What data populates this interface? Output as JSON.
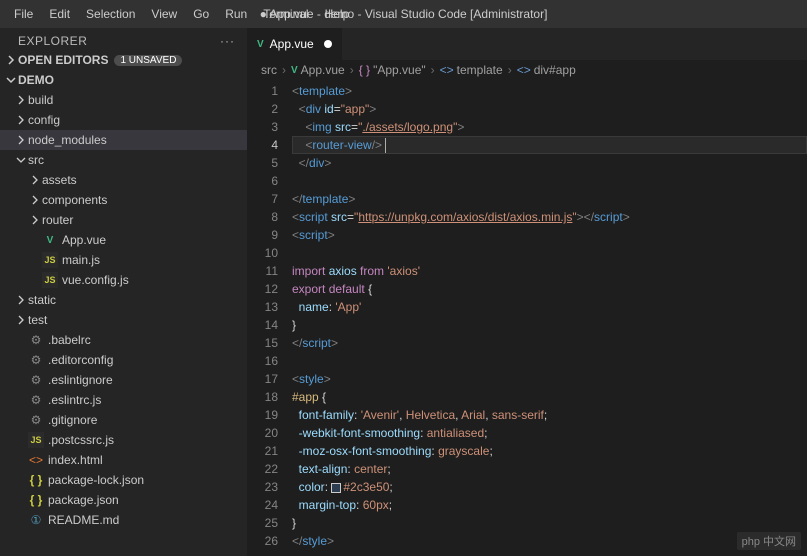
{
  "menu": [
    "File",
    "Edit",
    "Selection",
    "View",
    "Go",
    "Run",
    "Terminal",
    "Help"
  ],
  "title": {
    "modified": "●",
    "file": "App.vue - demo - Visual Studio Code [Administrator]"
  },
  "explorer": {
    "title": "EXPLORER",
    "openEditors": {
      "label": "OPEN EDITORS",
      "badge": "1 UNSAVED"
    },
    "projectName": "DEMO",
    "tree": [
      {
        "type": "folder",
        "expanded": false,
        "indent": 0,
        "label": "build"
      },
      {
        "type": "folder",
        "expanded": false,
        "indent": 0,
        "label": "config"
      },
      {
        "type": "folder",
        "expanded": false,
        "indent": 0,
        "label": "node_modules",
        "selected": true
      },
      {
        "type": "folder",
        "expanded": true,
        "indent": 0,
        "label": "src"
      },
      {
        "type": "folder",
        "expanded": false,
        "indent": 1,
        "label": "assets"
      },
      {
        "type": "folder",
        "expanded": false,
        "indent": 1,
        "label": "components"
      },
      {
        "type": "folder",
        "expanded": false,
        "indent": 1,
        "label": "router"
      },
      {
        "type": "vue",
        "indent": 1,
        "label": "App.vue"
      },
      {
        "type": "js",
        "indent": 1,
        "label": "main.js"
      },
      {
        "type": "js",
        "indent": 1,
        "label": "vue.config.js"
      },
      {
        "type": "folder",
        "expanded": false,
        "indent": 0,
        "label": "static"
      },
      {
        "type": "folder",
        "expanded": false,
        "indent": 0,
        "label": "test"
      },
      {
        "type": "gear",
        "indent": 0,
        "label": ".babelrc"
      },
      {
        "type": "gear",
        "indent": 0,
        "label": ".editorconfig"
      },
      {
        "type": "gear",
        "indent": 0,
        "label": ".eslintignore"
      },
      {
        "type": "gear",
        "indent": 0,
        "label": ".eslintrc.js"
      },
      {
        "type": "gear",
        "indent": 0,
        "label": ".gitignore"
      },
      {
        "type": "js",
        "indent": 0,
        "label": ".postcssrc.js"
      },
      {
        "type": "html",
        "indent": 0,
        "label": "index.html"
      },
      {
        "type": "json",
        "indent": 0,
        "label": "package-lock.json"
      },
      {
        "type": "json",
        "indent": 0,
        "label": "package.json"
      },
      {
        "type": "md",
        "indent": 0,
        "label": "README.md"
      }
    ]
  },
  "tab": {
    "label": "App.vue"
  },
  "breadcrumbs": [
    {
      "icon": "",
      "label": "src"
    },
    {
      "icon": "vue",
      "label": "App.vue"
    },
    {
      "icon": "brace",
      "label": "\"App.vue\""
    },
    {
      "icon": "tag",
      "label": "template"
    },
    {
      "icon": "tag",
      "label": "div#app"
    }
  ],
  "code": {
    "currentLine": 4,
    "lines": [
      {
        "n": 1,
        "html": "<span class='tk-tag'>&lt;</span><span class='tk-el'>template</span><span class='tk-tag'>&gt;</span>"
      },
      {
        "n": 2,
        "html": "  <span class='tk-tag'>&lt;</span><span class='tk-el'>div</span> <span class='tk-attr'>id</span><span class='tk-punc'>=</span><span class='tk-str'>\"app\"</span><span class='tk-tag'>&gt;</span>"
      },
      {
        "n": 3,
        "html": "    <span class='tk-tag'>&lt;</span><span class='tk-el'>img</span> <span class='tk-attr'>src</span><span class='tk-punc'>=</span><span class='tk-str'>\"</span><span class='tk-str-u'>./assets/logo.png</span><span class='tk-str'>\"</span><span class='tk-tag'>&gt;</span>"
      },
      {
        "n": 4,
        "html": "    <span class='tk-tag'>&lt;</span><span class='tk-el'>router-view</span><span class='tk-tag'>/&gt;</span> <span class='caret'></span>",
        "current": true
      },
      {
        "n": 5,
        "html": "  <span class='tk-tag'>&lt;/</span><span class='tk-el'>div</span><span class='tk-tag'>&gt;</span>"
      },
      {
        "n": 6,
        "html": ""
      },
      {
        "n": 7,
        "html": "<span class='tk-tag'>&lt;/</span><span class='tk-el'>template</span><span class='tk-tag'>&gt;</span>"
      },
      {
        "n": 8,
        "html": "<span class='tk-tag'>&lt;</span><span class='tk-el'>script</span> <span class='tk-attr'>src</span><span class='tk-punc'>=</span><span class='tk-str'>\"</span><span class='tk-str-u'>https://unpkg.com/axios/dist/axios.min.js</span><span class='tk-str'>\"</span><span class='tk-tag'>&gt;&lt;/</span><span class='tk-el'>script</span><span class='tk-tag'>&gt;</span>"
      },
      {
        "n": 9,
        "html": "<span class='tk-tag'>&lt;</span><span class='tk-el'>script</span><span class='tk-tag'>&gt;</span>"
      },
      {
        "n": 10,
        "html": ""
      },
      {
        "n": 11,
        "html": "<span class='tk-kw'>import</span> <span class='tk-ident'>axios</span> <span class='tk-kw'>from</span> <span class='tk-str'>'axios'</span>"
      },
      {
        "n": 12,
        "html": "<span class='tk-kw'>export</span> <span class='tk-kw'>default</span> <span class='tk-punc'>{</span>"
      },
      {
        "n": 13,
        "html": "  <span class='tk-ident'>name</span><span class='tk-punc'>:</span> <span class='tk-str'>'App'</span>"
      },
      {
        "n": 14,
        "html": "<span class='tk-punc'>}</span>"
      },
      {
        "n": 15,
        "html": "<span class='tk-tag'>&lt;/</span><span class='tk-el'>script</span><span class='tk-tag'>&gt;</span>"
      },
      {
        "n": 16,
        "html": ""
      },
      {
        "n": 17,
        "html": "<span class='tk-tag'>&lt;</span><span class='tk-el'>style</span><span class='tk-tag'>&gt;</span>"
      },
      {
        "n": 18,
        "html": "<span class='tk-css-sel'>#app</span> <span class='tk-punc'>{</span>"
      },
      {
        "n": 19,
        "html": "  <span class='tk-prop'>font-family</span><span class='tk-punc'>:</span> <span class='tk-css-val'>'Avenir'</span><span class='tk-punc'>,</span> <span class='tk-css-val'>Helvetica</span><span class='tk-punc'>,</span> <span class='tk-css-val'>Arial</span><span class='tk-punc'>,</span> <span class='tk-css-val'>sans-serif</span><span class='tk-punc'>;</span>"
      },
      {
        "n": 20,
        "html": "  <span class='tk-prop'>-webkit-font-smoothing</span><span class='tk-punc'>:</span> <span class='tk-css-val'>antialiased</span><span class='tk-punc'>;</span>"
      },
      {
        "n": 21,
        "html": "  <span class='tk-prop'>-moz-osx-font-smoothing</span><span class='tk-punc'>:</span> <span class='tk-css-val'>grayscale</span><span class='tk-punc'>;</span>"
      },
      {
        "n": 22,
        "html": "  <span class='tk-prop'>text-align</span><span class='tk-punc'>:</span> <span class='tk-css-val'>center</span><span class='tk-punc'>;</span>"
      },
      {
        "n": 23,
        "html": "  <span class='tk-prop'>color</span><span class='tk-punc'>:</span> <span class='color-swatch'></span><span class='tk-css-val'>#2c3e50</span><span class='tk-punc'>;</span>"
      },
      {
        "n": 24,
        "html": "  <span class='tk-prop'>margin-top</span><span class='tk-punc'>:</span> <span class='tk-css-val'>60px</span><span class='tk-punc'>;</span>"
      },
      {
        "n": 25,
        "html": "<span class='tk-punc'>}</span>"
      },
      {
        "n": 26,
        "html": "<span class='tk-tag'>&lt;/</span><span class='tk-el'>style</span><span class='tk-tag'>&gt;</span>"
      }
    ]
  },
  "watermark": "php 中文网"
}
